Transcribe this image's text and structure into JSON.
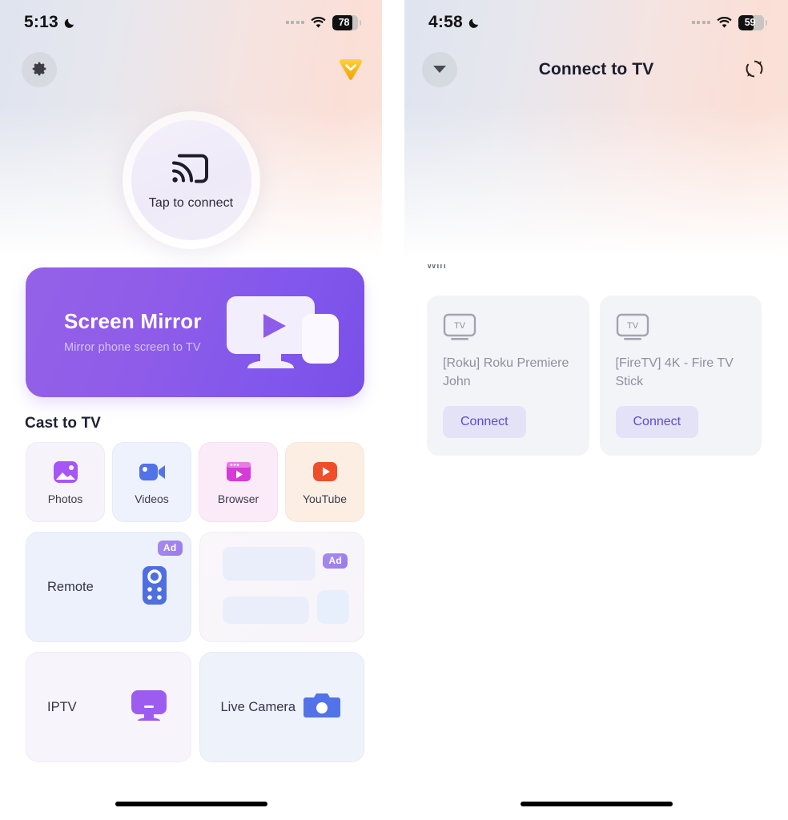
{
  "left": {
    "status": {
      "time": "5:13",
      "moon_icon": "moon-icon",
      "wifi_icon": "wifi-icon",
      "battery": "78"
    },
    "topbar": {
      "settings_icon": "gear-icon",
      "premium_icon": "premium-diamond-icon"
    },
    "connect": {
      "label": "Tap to connect",
      "icon": "cast-icon"
    },
    "mirror": {
      "title": "Screen Mirror",
      "subtitle": "Mirror phone screen to TV",
      "art_icon": "tv-and-phone-play-icon",
      "bg_color": "#8a5ae8"
    },
    "section": {
      "title": "Cast to TV"
    },
    "tiles": [
      {
        "label": "Photos",
        "icon": "photo-icon",
        "bg": "#f7f3fb",
        "icon_color": "#a855f7"
      },
      {
        "label": "Videos",
        "icon": "camcorder-icon",
        "bg": "#eef2fd",
        "icon_color": "#5272e8"
      },
      {
        "label": "Browser",
        "icon": "browser-play-icon",
        "bg": "#fbeaf8",
        "icon_color": "#d63ad8"
      },
      {
        "label": "YouTube",
        "icon": "youtube-icon",
        "bg": "#fdeee4",
        "icon_color": "#ef4e2a"
      }
    ],
    "wide_cards": [
      {
        "label": "Remote",
        "icon": "remote-control-icon",
        "bg": "#edf1fb",
        "badge": "Ad"
      },
      {
        "label": "IPTV",
        "icon": "iptv-monitor-icon",
        "bg": "#f8f4fb",
        "badge": ""
      },
      {
        "label": "Live Camera",
        "icon": "camera-icon",
        "bg": "#eef2fb",
        "badge": ""
      }
    ],
    "ad_card": {
      "badge": "Ad"
    },
    "home_indicator": "home-indicator"
  },
  "right": {
    "status": {
      "time": "4:58",
      "moon_icon": "moon-icon",
      "wifi_icon": "wifi-icon",
      "battery": "59"
    },
    "topbar": {
      "title": "Connect to TV",
      "back_icon": "chevron-down-icon",
      "refresh_icon": "refresh-icon"
    },
    "illustration": "tv-phone-wifi-icon",
    "confirm_text": "Please confirm the device is connected to the same wifi",
    "devices": [
      {
        "icon": "tv-icon",
        "badge_label": "TV",
        "name": "[Roku] Roku Premiere John",
        "button": "Connect"
      },
      {
        "icon": "tv-icon",
        "badge_label": "TV",
        "name": "[FireTV] 4K - Fire TV Stick",
        "button": "Connect"
      }
    ],
    "home_indicator": "home-indicator"
  },
  "colors": {
    "accent_purple": "#8a5ae8",
    "connect_btn_bg": "#e4e2f7",
    "connect_btn_text": "#5b4bd6",
    "device_card_bg": "#f2f4f8",
    "premium_gold": "#f5b81c"
  }
}
